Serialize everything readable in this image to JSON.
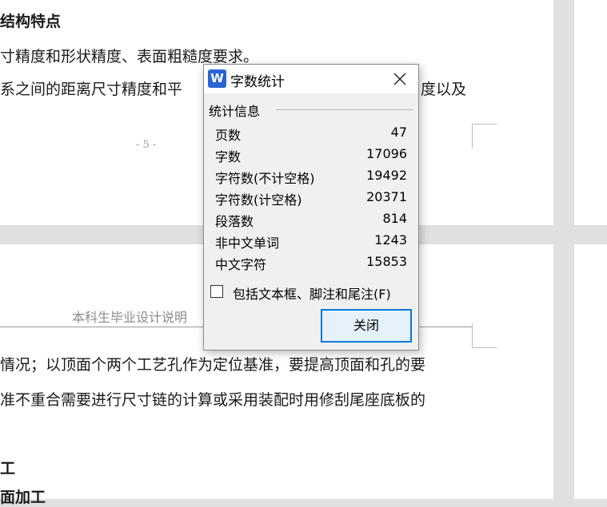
{
  "document": {
    "page1_lines": [
      "结构特点",
      "寸精度和形状精度、表面粗糙度要求。",
      "系之间的距离尺寸精度和平",
      "度以及"
    ],
    "page_number": "- 5 -",
    "page2_header": "本科生毕业设计说明",
    "page2_lines": [
      "情况；以顶面个两个工艺孔作为定位基准，要提高顶面和孔的要",
      "准不重合需要进行尺寸链的计算或采用装配时用修刮尾座底板的",
      "工",
      "面加工"
    ]
  },
  "dialog": {
    "app_icon_letter": "W",
    "title": "字数统计",
    "group_label": "统计信息",
    "stats": [
      {
        "label": "页数",
        "value": "47"
      },
      {
        "label": "字数",
        "value": "17096"
      },
      {
        "label": "字符数(不计空格)",
        "value": "19492"
      },
      {
        "label": "字符数(计空格)",
        "value": "20371"
      },
      {
        "label": "段落数",
        "value": "814"
      },
      {
        "label": "非中文单词",
        "value": "1243"
      },
      {
        "label": "中文字符",
        "value": "15853"
      }
    ],
    "checkbox_label": "包括文本框、脚注和尾注(F)",
    "checkbox_checked": false,
    "close_button_label": "关闭"
  },
  "colors": {
    "accent": "#0078d7",
    "app_icon": "#2a63d3",
    "background": "#e0e0e0"
  }
}
